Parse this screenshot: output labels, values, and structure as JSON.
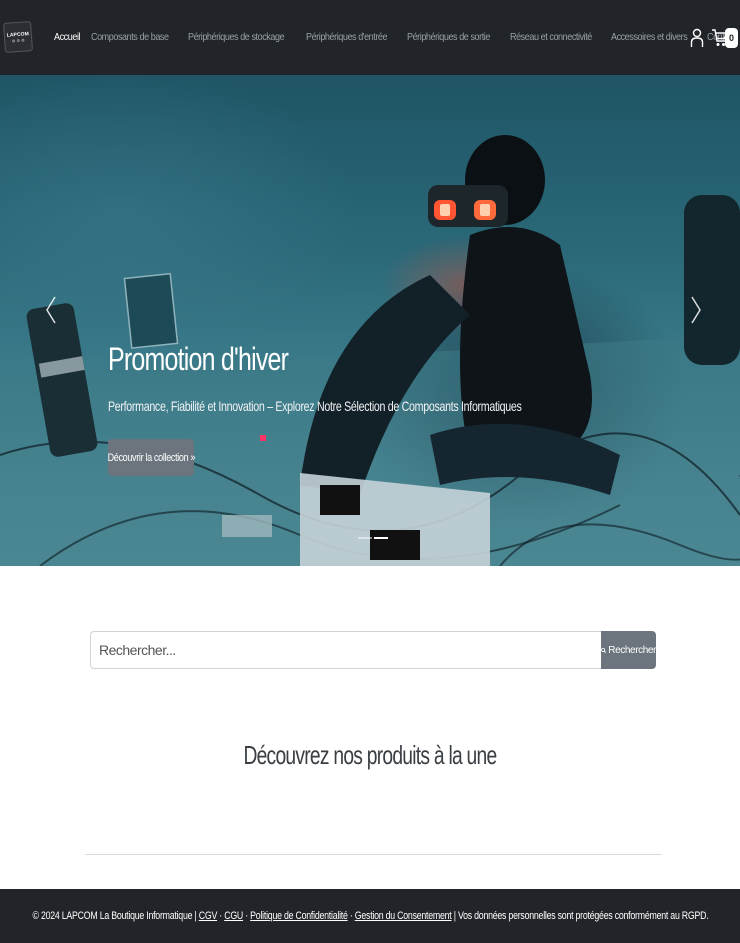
{
  "brand": {
    "logo_line1": "LAPCOM",
    "logo_line2": "⚙ ⚙ ⚙"
  },
  "nav": {
    "items": [
      {
        "label": "Accueil",
        "active": true
      },
      {
        "label": "Composants de base"
      },
      {
        "label": "Périphériques de stockage"
      },
      {
        "label": "Périphériques d'entrée"
      },
      {
        "label": "Périphériques de sortie"
      },
      {
        "label": "Réseau et connectivité"
      },
      {
        "label": "Accessoires et divers"
      },
      {
        "label": "Contact"
      }
    ],
    "user_icon": "user-icon",
    "cart_icon": "cart-icon",
    "cart_count": "0"
  },
  "hero": {
    "title": "Promotion d'hiver",
    "subtitle": "Performance, Fiabilité et Innovation – Explorez Notre Sélection de Composants Informatiques",
    "button_label": "Découvrir la collection »",
    "prev_icon": "chevron-left-icon",
    "next_icon": "chevron-right-icon",
    "active_slide": 2,
    "slide_count": 2
  },
  "search": {
    "placeholder": "Rechercher...",
    "button_label": "Rechercher",
    "button_icon": "search-icon"
  },
  "featured": {
    "heading": "Découvrez nos produits à la une"
  },
  "footer": {
    "copyright": "© 2024 LAPCOM La Boutique Informatique |",
    "links": [
      "CGV",
      "CGU",
      "Politique de Confidentialité",
      "Gestion du Consentement"
    ],
    "separator": "·",
    "notice": "| Vos données personnelles sont protégées conformément au RGPD."
  },
  "colors": {
    "navbar_bg": "#212529",
    "footer_bg": "#212529",
    "button_grey": "#6c757d",
    "hero_teal": "#2a6878"
  }
}
